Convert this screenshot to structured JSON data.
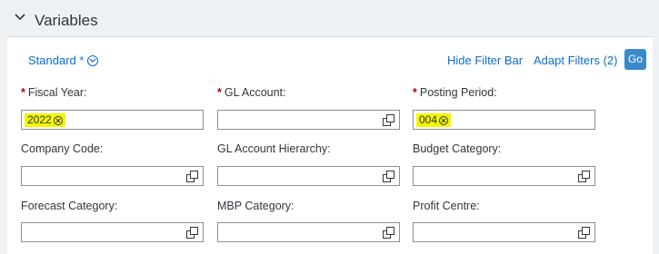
{
  "header": {
    "title": "Variables"
  },
  "toolbar": {
    "variant_label": "Standard *",
    "hide_filter_bar": "Hide Filter Bar",
    "adapt_filters": "Adapt Filters (2)",
    "go": "Go"
  },
  "filters": {
    "fiscal_year": {
      "label": "Fiscal Year:",
      "required": "*",
      "token": "2022"
    },
    "gl_account": {
      "label": "GL Account:",
      "required": "*"
    },
    "posting_period": {
      "label": "Posting Period:",
      "required": "*",
      "token": "004"
    },
    "company_code": {
      "label": "Company Code:"
    },
    "gl_account_hierarchy": {
      "label": "GL Account Hierarchy:"
    },
    "budget_category": {
      "label": "Budget Category:"
    },
    "forecast_category": {
      "label": "Forecast Category:"
    },
    "mbp_category": {
      "label": "MBP Category:"
    },
    "profit_centre": {
      "label": "Profit Centre:"
    }
  },
  "colors": {
    "link": "#0a6ed1",
    "required": "#bb0000",
    "highlight": "#f5f500",
    "go_button": "#3a89c9"
  }
}
